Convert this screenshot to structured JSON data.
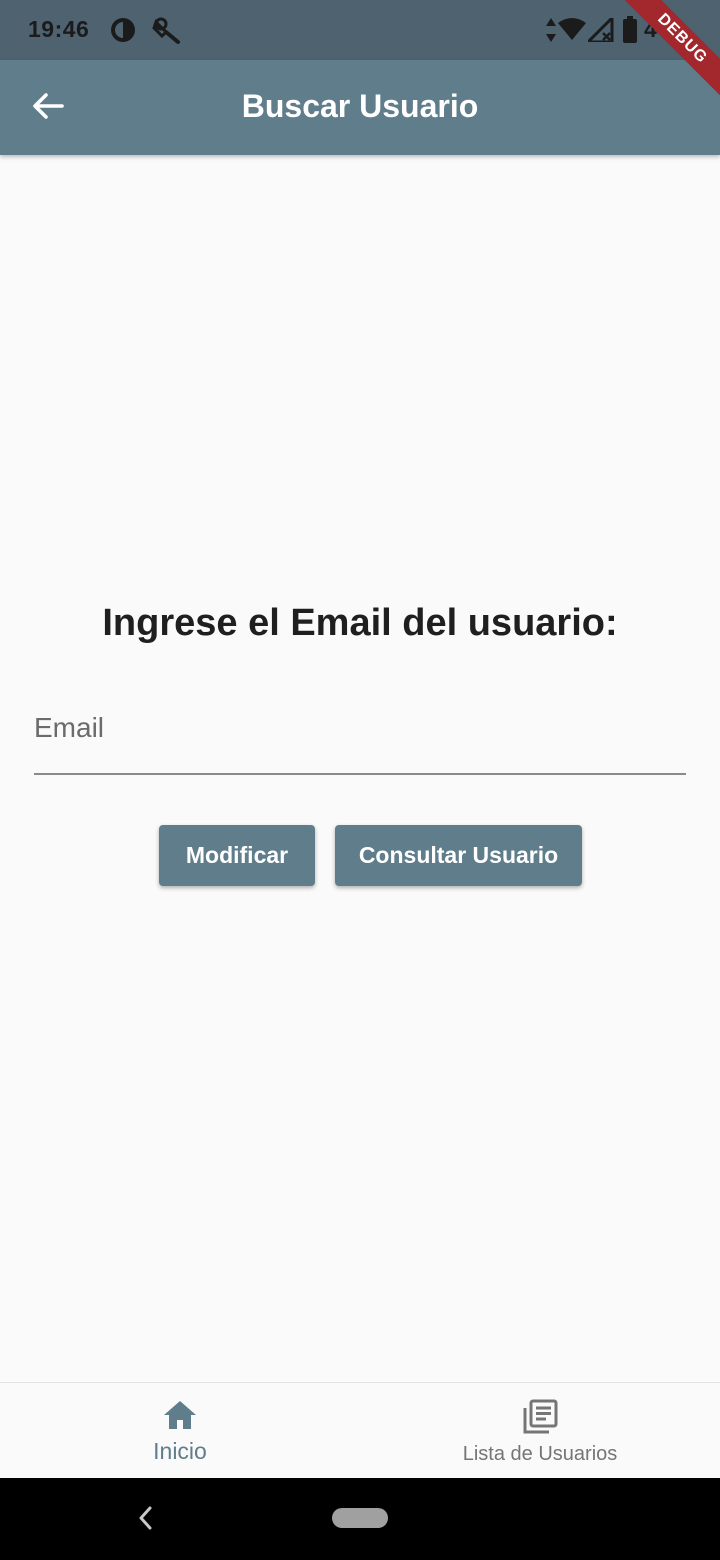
{
  "status_bar": {
    "time": "19:46",
    "battery_text": "4",
    "icons": [
      "o-app-icon",
      "tools-icon",
      "data-arrows-icon",
      "wifi-icon",
      "signal-icon",
      "battery-icon"
    ]
  },
  "debug_banner": {
    "label": "DEBUG"
  },
  "app_bar": {
    "title": "Buscar Usuario",
    "back_icon": "arrow-left-icon"
  },
  "main": {
    "heading": "Ingrese el Email del usuario:",
    "email_field": {
      "placeholder": "Email",
      "value": ""
    },
    "buttons": {
      "modificar": "Modificar",
      "consultar": "Consultar Usuario"
    }
  },
  "bottom_nav": {
    "items": [
      {
        "label": "Inicio",
        "icon": "home-icon",
        "active": true
      },
      {
        "label": "Lista de Usuarios",
        "icon": "library-books-icon",
        "active": false
      }
    ]
  },
  "colors": {
    "primary": "#607d8b",
    "status_bar": "#4e6270",
    "background": "#fafafa",
    "debug_ribbon": "#a3282d"
  }
}
